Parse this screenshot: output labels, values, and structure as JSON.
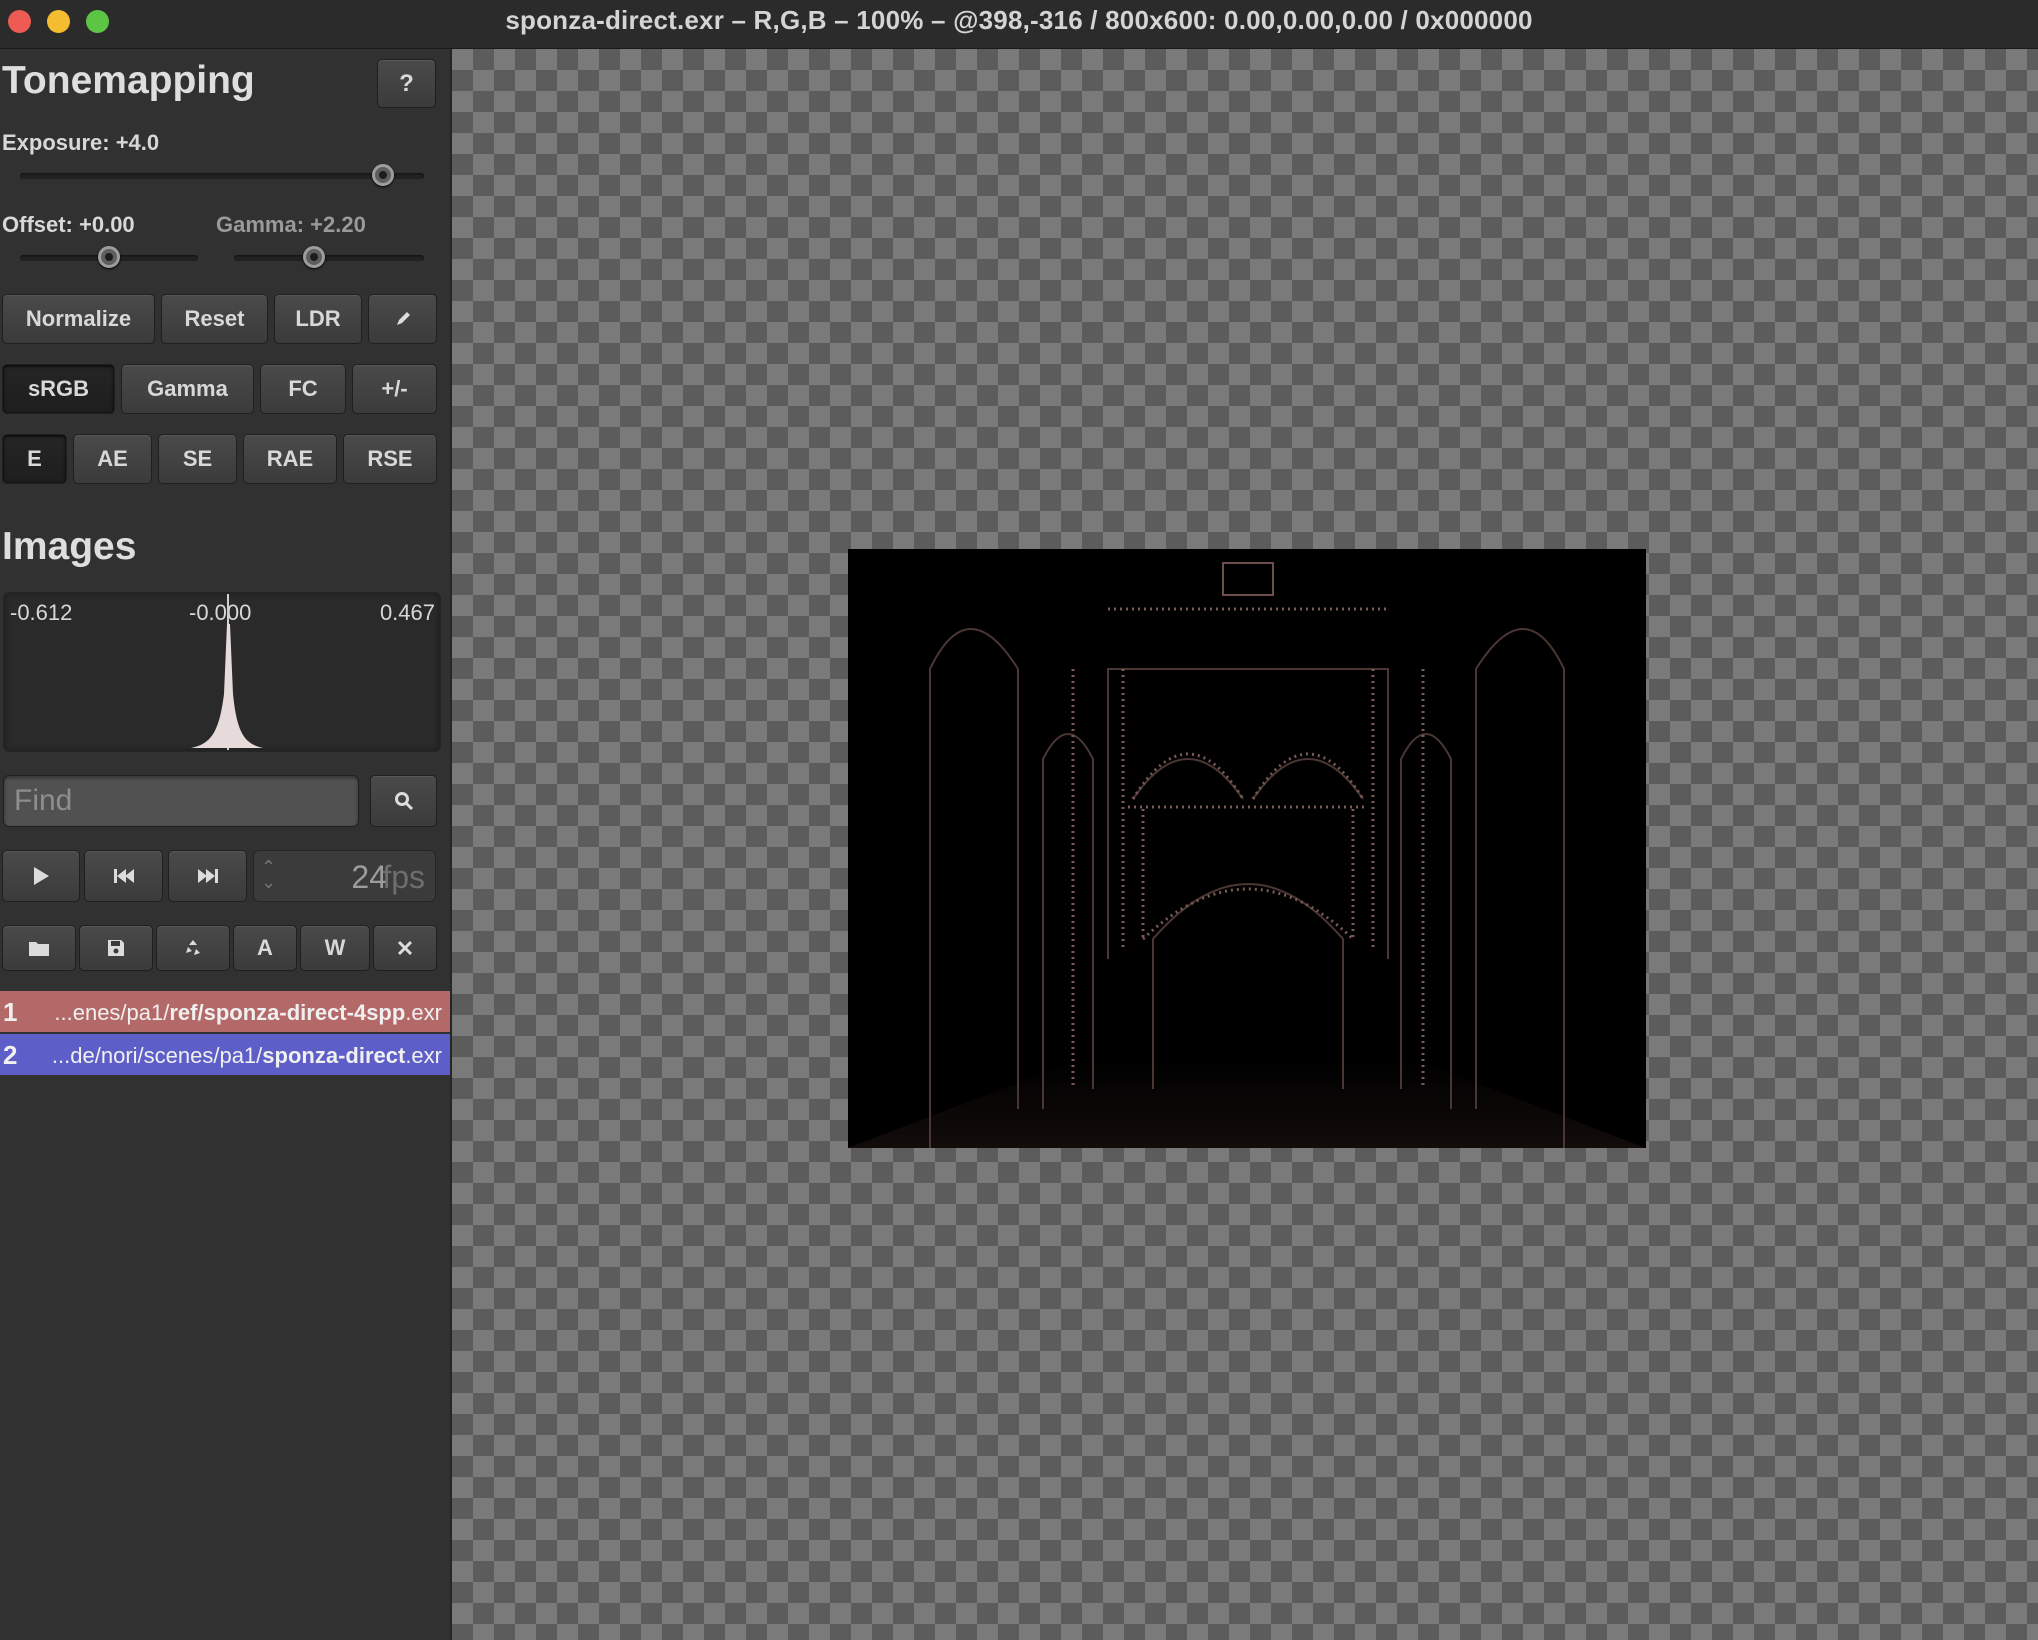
{
  "window": {
    "title": "sponza-direct.exr – R,G,B – 100% – @398,-316 / 800x600: 0.00,0.00,0.00 / 0x000000"
  },
  "tonemapping": {
    "title": "Tonemapping",
    "help_label": "?",
    "exposure_label": "Exposure: +4.0",
    "exposure_value": 4.0,
    "offset_label": "Offset: +0.00",
    "offset_value": 0.0,
    "gamma_label": "Gamma: +2.20",
    "gamma_value": 2.2,
    "buttons": {
      "normalize": "Normalize",
      "reset": "Reset",
      "ldr": "LDR"
    },
    "curves": {
      "srgb": "sRGB",
      "gamma": "Gamma",
      "fc": "FC",
      "plusminus": "+/-",
      "selected": "sRGB"
    },
    "metrics": {
      "e": "E",
      "ae": "AE",
      "se": "SE",
      "rae": "RAE",
      "rse": "RSE",
      "selected": "E"
    }
  },
  "images": {
    "title": "Images",
    "histogram": {
      "min": "-0.612",
      "mid": "-0.000",
      "max": "0.467"
    },
    "find_placeholder": "Find",
    "fps_value": "24",
    "fps_unit": "fps",
    "action_labels": {
      "a": "A",
      "w": "W"
    },
    "files": [
      {
        "index": "1",
        "prefix": "...enes/pa1/",
        "bold": "ref/sponza-direct-4spp",
        "suffix": ".exr",
        "color": "#b46969"
      },
      {
        "index": "2",
        "prefix": "...de/nori/scenes/pa1/",
        "bold": "sponza-direct",
        "suffix": ".exr",
        "color": "#5e5ec9"
      }
    ]
  },
  "icons": {
    "pen": "pen-icon",
    "search": "search-icon",
    "play": "play-icon",
    "skip_back": "skip-back-icon",
    "skip_forward": "skip-forward-icon",
    "folder": "folder-icon",
    "save": "save-icon",
    "reload": "reload-icon",
    "close": "close-icon"
  }
}
